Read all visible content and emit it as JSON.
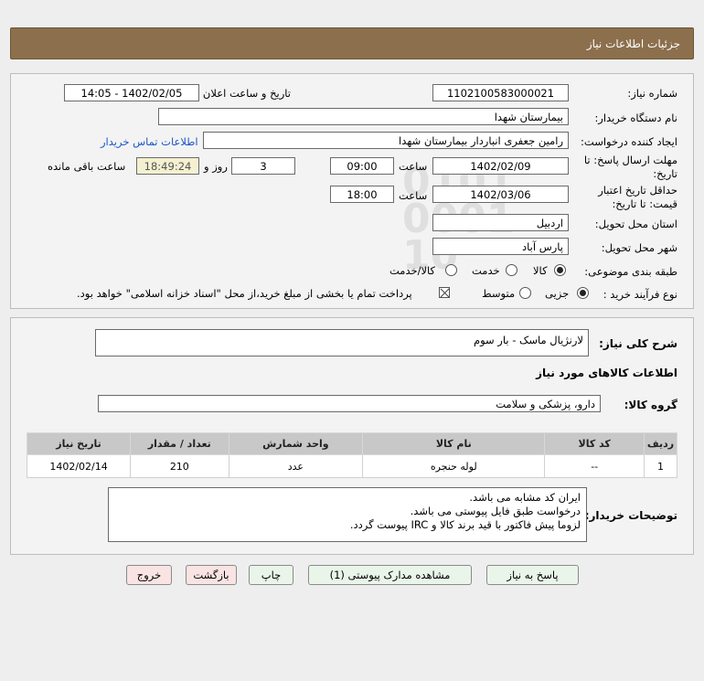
{
  "header": {
    "title": "جزئیات اطلاعات نیاز"
  },
  "form": {
    "need_number_label": "شماره نیاز:",
    "need_number": "1102100583000021",
    "announce_label": "تاریخ و ساعت اعلان عمومی:",
    "announce_value": "1402/02/05 - 14:05",
    "buyer_org_label": "نام دستگاه خریدار:",
    "buyer_org": "بیمارستان شهدا",
    "creator_label": "ایجاد کننده درخواست:",
    "creator": "رامین جعفری انباردار بیمارستان شهدا",
    "contact_link": "اطلاعات تماس خریدار",
    "deadline_label_line1": "مهلت ارسال پاسخ: تا",
    "deadline_label_line2": "تاریخ:",
    "deadline_date": "1402/02/09",
    "time_label": "ساعت",
    "deadline_time": "09:00",
    "days_value": "3",
    "days_label": "روز و",
    "remaining_time": "18:49:24",
    "remaining_label": "ساعت باقی مانده",
    "validity_label_line1": "حداقل تاریخ اعتبار",
    "validity_label_line2": "قیمت: تا تاریخ:",
    "validity_date": "1402/03/06",
    "validity_time_label": "ساعت",
    "validity_time": "18:00",
    "province_label": "استان محل تحویل:",
    "province": "اردبیل",
    "city_label": "شهر محل تحویل:",
    "city": "پارس آباد",
    "category_label": "طبقه بندی موضوعی:",
    "category_options": [
      "کالا",
      "خدمت",
      "کالا/خدمت"
    ],
    "category_selected": 0,
    "process_label": "نوع فرآیند خرید :",
    "process_options": [
      "جزیی",
      "متوسط"
    ],
    "process_selected": 0,
    "payment_note": "پرداخت تمام یا بخشی از مبلغ خرید،از محل \"اسناد خزانه اسلامی\" خواهد بود."
  },
  "details": {
    "summary_label": "شرح کلی نیاز:",
    "summary": "لارنژیال ماسک - بار سوم",
    "goods_info_title": "اطلاعات کالاهای مورد نیاز",
    "group_label": "گروه کالا:",
    "group": "دارو، پزشکی و سلامت",
    "table": {
      "headers": [
        "ردیف",
        "کد کالا",
        "نام کالا",
        "واحد شمارش",
        "تعداد / مقدار",
        "تاریخ نیاز"
      ],
      "rows": [
        [
          "1",
          "--",
          "لوله حنجره",
          "عدد",
          "210",
          "1402/02/14"
        ]
      ]
    },
    "notes_label": "توضیحات خریدار:",
    "notes": [
      "ایران کد مشابه می باشد.",
      "درخواست طبق فایل پیوستی می باشد.",
      "لزوما پیش فاکتور با قید برند کالا و IRC پیوست گردد."
    ]
  },
  "buttons": {
    "reply": "پاسخ به نیاز",
    "view_docs": "مشاهده مدارک پیوستی (1)",
    "print": "چاپ",
    "back": "بازگشت",
    "exit": "خروج"
  }
}
